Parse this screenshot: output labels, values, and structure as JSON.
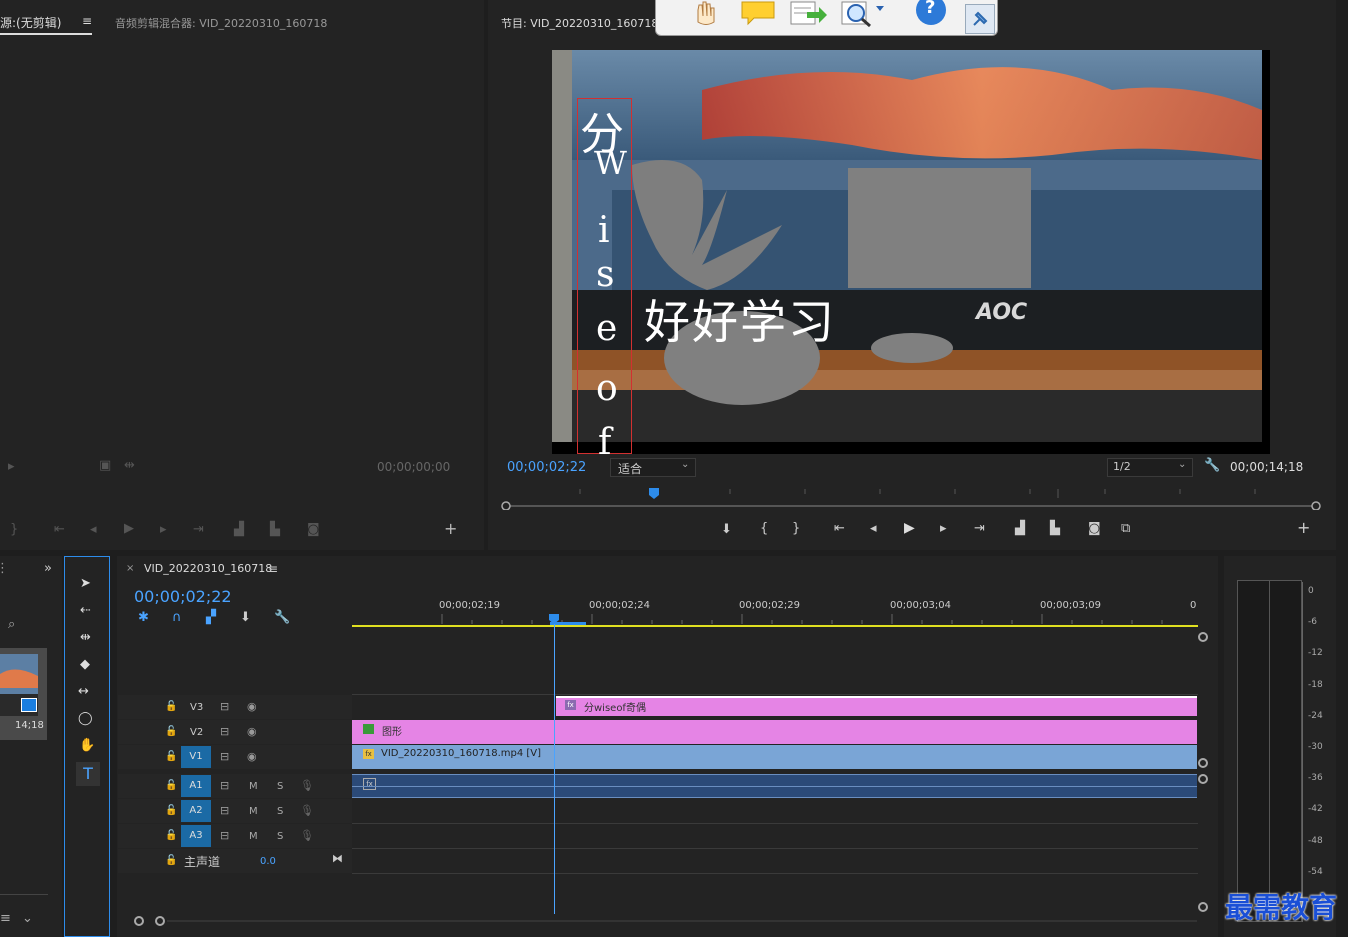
{
  "source_panel": {
    "tab_label": "源:(无剪辑)",
    "tab_menu": "≡",
    "audio_mixer_tab": "音频剪辑混合器: VID_20220310_160718",
    "timecode": "00;00;00;00"
  },
  "program_panel": {
    "title": "节目: VID_20220310_160718",
    "current_timecode": "00;00;02;22",
    "fit_label": "适合",
    "resolution": "1/2",
    "duration_timecode": "00;00;14;18"
  },
  "video_overlay": {
    "vertical_chars": [
      "分",
      "W",
      "i",
      "s",
      "e",
      "o",
      "f"
    ],
    "horizontal_text": "好好学习",
    "monitor_brand": "AOC"
  },
  "floating_toolbar": {
    "icons": [
      "hand-icon",
      "comment-icon",
      "export-icon",
      "zoom-icon",
      "help-icon",
      "pin-icon"
    ],
    "help_glyph": "?"
  },
  "project_panel": {
    "thumb_duration": "14;18"
  },
  "timeline": {
    "sequence_name": "VID_20220310_160718",
    "menu": "≡",
    "close": "×",
    "playhead_timecode": "00;00;02;22",
    "ruler_labels": [
      "00;00;02;19",
      "00;00;02;24",
      "00;00;02;29",
      "00;00;03;04",
      "00;00;03;09",
      "0"
    ],
    "video_tracks": [
      {
        "name": "V3",
        "active": false
      },
      {
        "name": "V2",
        "active": false
      },
      {
        "name": "V1",
        "active": true
      }
    ],
    "audio_tracks": [
      {
        "name": "A1",
        "m": "M",
        "s": "S"
      },
      {
        "name": "A2",
        "m": "M",
        "s": "S"
      },
      {
        "name": "A3",
        "m": "M",
        "s": "S"
      }
    ],
    "master_track": {
      "label": "主声道",
      "value": "0.0"
    },
    "clips": {
      "v3": "分wiseof奇偶",
      "v2": "图形",
      "v1": "VID_20220310_160718.mp4 [V]"
    }
  },
  "audio_meter": {
    "scale": [
      "0",
      "-6",
      "-12",
      "-18",
      "-24",
      "-30",
      "-36",
      "-42",
      "-48",
      "-54"
    ]
  },
  "watermark": "最需教育",
  "colors": {
    "accent_blue": "#2d8ceb",
    "clip_pink": "#e584e5",
    "clip_blue": "#7aa5d6",
    "audio_dark_blue": "#2b4a78",
    "timeline_yellow": "#e0e020"
  }
}
